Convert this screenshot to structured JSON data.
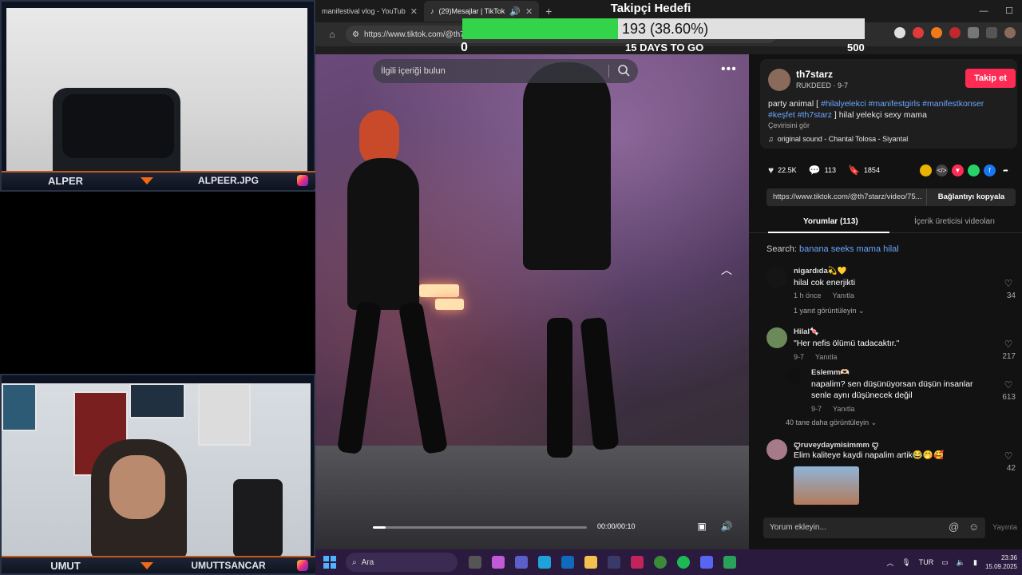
{
  "webcams": {
    "top": {
      "name": "ALPER",
      "handle": "ALPEER.JPG"
    },
    "bottom": {
      "name": "UMUT",
      "handle": "UMUTTSANCAR"
    }
  },
  "browser": {
    "tabs": [
      {
        "title": "manifestival vlog - YouTub",
        "active": false
      },
      {
        "title": "(29)Mesajlar | TikTok",
        "active": true
      }
    ],
    "new_tab": "+",
    "url": "https://www.tiktok.com/@th7",
    "window_controls": [
      "—",
      "☐"
    ]
  },
  "goal": {
    "title": "Takipçi Hedefi",
    "progress_text": "193 (38.60%)",
    "progress_fraction": 0.386,
    "min_label": "0",
    "days_label": "15 DAYS TO GO",
    "max_label": "500"
  },
  "video": {
    "search_placeholder": "İlgili içeriği bulun",
    "time": "00:00/00:10",
    "progress_fraction": 0.06
  },
  "post": {
    "username": "th7starz",
    "subname": "RUKDEED · 9-7",
    "follow_label": "Takip et",
    "caption_prefix": "party animal [ ",
    "hashtags_line1": "#hilalyelekci #manifestgirls #manifestkonser",
    "hashtags_line2": "#keşfet #th7starz",
    "caption_suffix": " ] hilal yelekçi sexy mama",
    "see_translation": "Çevirisini gör",
    "sound": "original sound - Chantal Tolosa - Siyantal",
    "likes": "22.5K",
    "comments": "113",
    "saves": "1854",
    "link": "https://www.tiktok.com/@th7starz/video/75...",
    "copy_label": "Bağlantıyı kopyala"
  },
  "tabs": {
    "comments": "Yorumlar (113)",
    "creator_videos": "İçerik üreticisi videoları"
  },
  "search_suggestion": {
    "prefix": "Search: ",
    "query": "banana seeks mama hilal"
  },
  "comments": [
    {
      "name": "nigardıda💫💛",
      "text": "hilal cok enerjikti",
      "time": "1 h önce",
      "reply": "Yanıtla",
      "likes": "34",
      "view_replies": "1 yanıt görüntüleyin ⌄"
    },
    {
      "name": "Hilal🍬",
      "text": "\"Her nefis ölümü tadacaktır.\"",
      "time": "9-7",
      "reply": "Yanıtla",
      "likes": "217"
    },
    {
      "name": "Eslemm🫶🏻",
      "text": "napalim? sen düşünüyorsan düşün insanlar senle aynı düşünecek değil",
      "time": "9-7",
      "reply": "Yanıtla",
      "likes": "613",
      "view_replies": "40 tane daha görüntüleyin ⌄"
    },
    {
      "name": "ꨄ︎ruveydaymisimmm ꨄ︎",
      "text": "Elim kaliteye kaydi napalim artik😂🤭🥰",
      "likes": "42"
    }
  ],
  "comment_input": {
    "placeholder": "Yorum ekleyin...",
    "post_label": "Yayınla"
  },
  "taskbar": {
    "search_label": "Ara",
    "lang": "TUR",
    "time": "23:36",
    "date": "15.09.2025"
  },
  "colors": {
    "follow": "#fe2c55",
    "hashtag": "#6aa6ff",
    "goal_fill": "#34d44a",
    "taskbar": "#2a1a3e"
  }
}
